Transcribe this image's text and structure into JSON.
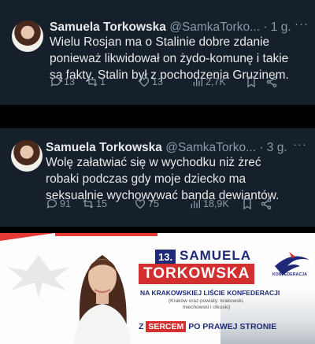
{
  "tweets": [
    {
      "name": "Samuela Torkowska",
      "handle": "@SamkaTorko...",
      "dot": "·",
      "time": "1 g.",
      "more": "···",
      "text": "Wielu Rosjan ma o Stalinie dobre zdanie ponieważ likwidował on żydo-komunę i takie są fakty. Stalin był z pochodzenia Gruzinem.",
      "replies": "13",
      "retweets": "1",
      "likes": "13",
      "views": "2,7K"
    },
    {
      "name": "Samuela Torkowska",
      "handle": "@SamkaTorko...",
      "dot": "·",
      "time": "3 g.",
      "more": "···",
      "text": "Wolę załatwiać się w wychodku niż żreć robaki podczas gdy moje dziecko ma seksualnie wychowywać banda dewiantów.",
      "replies": "91",
      "retweets": "15",
      "likes": "75",
      "views": "18,9K"
    }
  ],
  "banner": {
    "number": "13.",
    "first_name": "SAMUELA",
    "last_name": "TORKOWSKA",
    "subtitle": "NA KRAKOWSKIEJ LIŚCIE KONFEDERACJI",
    "region": "(Kraków oraz powiaty: krakowski, miechowski i olkuski)",
    "slogan_pre": "Z",
    "slogan_mid": "SERCEM",
    "slogan_post": "PO PRAWEJ STRONIE",
    "logo_text": "KONFEDERACJA"
  },
  "colors": {
    "tweet_bg": "#15202b",
    "text": "#e7e9ea",
    "muted": "#8b98a5",
    "navy": "#1e2a78",
    "red": "#d32f2f"
  }
}
